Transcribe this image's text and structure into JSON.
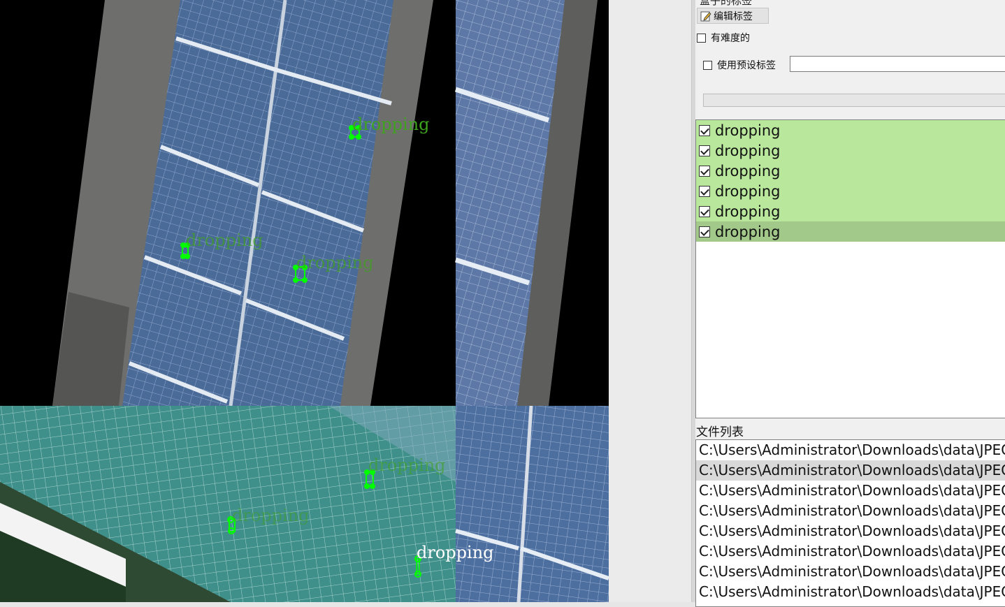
{
  "dock": {
    "title": "盒子的标签",
    "edit_button": "编辑标签",
    "difficult_label": "有难度的",
    "difficult_checked": false,
    "preset_label": "使用预设标签",
    "preset_checked": false,
    "preset_value": ""
  },
  "labels": [
    {
      "text": "dropping",
      "checked": true,
      "selected": false
    },
    {
      "text": "dropping",
      "checked": true,
      "selected": false
    },
    {
      "text": "dropping",
      "checked": true,
      "selected": false
    },
    {
      "text": "dropping",
      "checked": true,
      "selected": false
    },
    {
      "text": "dropping",
      "checked": true,
      "selected": false
    },
    {
      "text": "dropping",
      "checked": true,
      "selected": true
    }
  ],
  "file_list": {
    "header": "文件列表",
    "items": [
      {
        "path": "C:\\Users\\Administrator\\Downloads\\data\\JPEG",
        "selected": false
      },
      {
        "path": "C:\\Users\\Administrator\\Downloads\\data\\JPEG",
        "selected": true
      },
      {
        "path": "C:\\Users\\Administrator\\Downloads\\data\\JPEG",
        "selected": false
      },
      {
        "path": "C:\\Users\\Administrator\\Downloads\\data\\JPEG",
        "selected": false
      },
      {
        "path": "C:\\Users\\Administrator\\Downloads\\data\\JPEG",
        "selected": false
      },
      {
        "path": "C:\\Users\\Administrator\\Downloads\\data\\JPEG",
        "selected": false
      },
      {
        "path": "C:\\Users\\Administrator\\Downloads\\data\\JPEG",
        "selected": false
      },
      {
        "path": "C:\\Users\\Administrator\\Downloads\\data\\JPEG",
        "selected": false
      }
    ]
  },
  "canvas": {
    "annotations": [
      {
        "label": "dropping"
      },
      {
        "label": "dropping"
      },
      {
        "label": "dropping"
      },
      {
        "label": "dropping"
      },
      {
        "label": "dropping"
      },
      {
        "label": "dropping"
      }
    ]
  },
  "colors": {
    "box_green": "#00ff00",
    "label_green": "#3fa21f",
    "label_highlight": "#b9e89c",
    "label_selected": "#a2c98a"
  }
}
